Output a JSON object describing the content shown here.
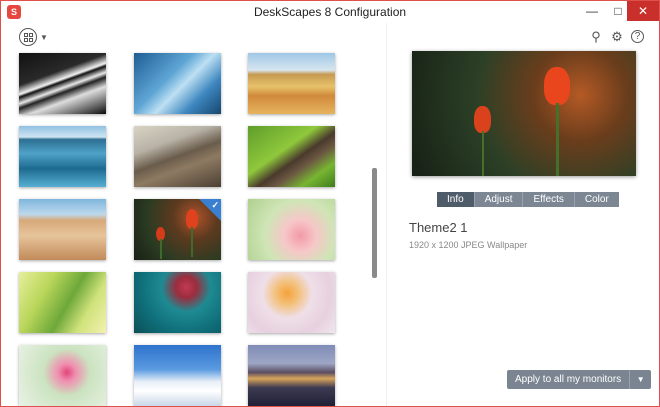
{
  "window": {
    "title": "DeskScapes 8 Configuration",
    "app_icon_glyph": "S",
    "minimize_glyph": "—",
    "maximize_glyph": "□",
    "close_glyph": "✕"
  },
  "toolbar": {
    "view_icon": "view-grid-icon",
    "search_icon": "search-icon",
    "settings_icon": "gear-icon",
    "help_icon": "help-icon",
    "search_glyph": "⚲",
    "settings_glyph": "⚙",
    "help_glyph": "?"
  },
  "gallery": {
    "selected_index": 7,
    "items": [
      {
        "name": "piano-keys"
      },
      {
        "name": "blue-ice"
      },
      {
        "name": "golden-hills"
      },
      {
        "name": "blue-ocean-rocks"
      },
      {
        "name": "rocky-shoreline"
      },
      {
        "name": "green-field-road"
      },
      {
        "name": "sand-dunes"
      },
      {
        "name": "red-tulips-theme2"
      },
      {
        "name": "pink-flower"
      },
      {
        "name": "green-leaves"
      },
      {
        "name": "red-flowers-teal"
      },
      {
        "name": "orange-lily"
      },
      {
        "name": "pink-flower-green"
      },
      {
        "name": "daisies-blue-sky"
      },
      {
        "name": "city-night"
      }
    ]
  },
  "preview": {
    "tabs": [
      "Info",
      "Adjust",
      "Effects",
      "Color"
    ],
    "active_tab": "Info",
    "theme_name": "Theme2 1",
    "description": "1920 x 1200 JPEG Wallpaper"
  },
  "actions": {
    "apply_label": "Apply to all my monitors",
    "apply_dropdown_glyph": "▼"
  },
  "colors": {
    "accent_close": "#c9302c",
    "selection_check": "#3b7fd1",
    "tab_active": "#4e5b69",
    "tab_inactive": "#7c8793"
  }
}
